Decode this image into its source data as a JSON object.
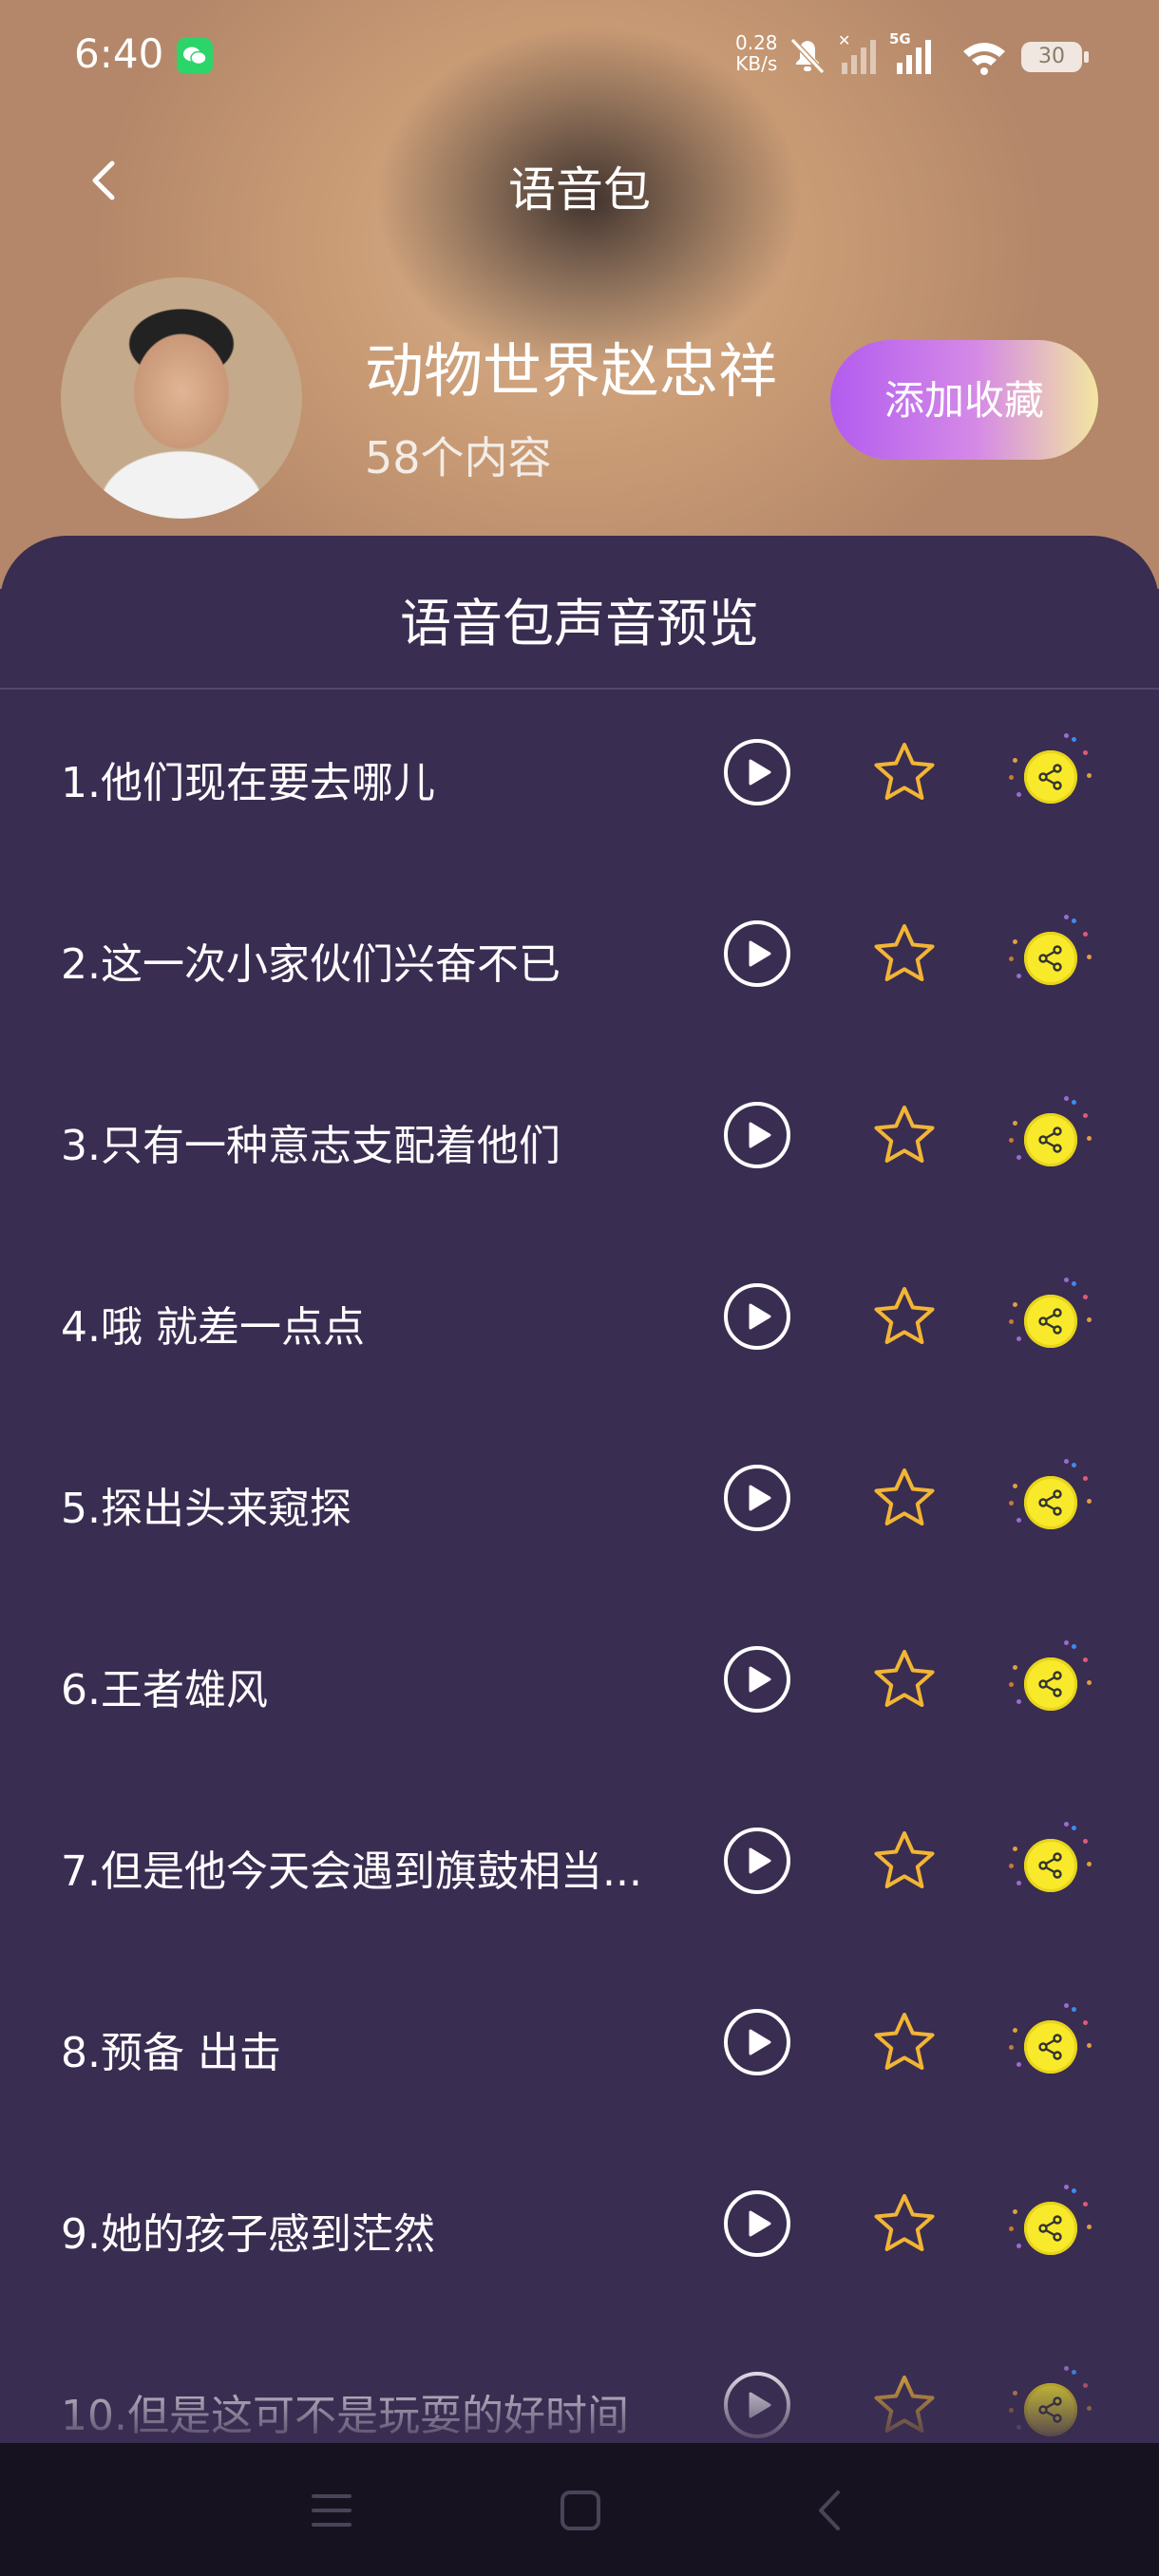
{
  "status_bar": {
    "time": "6:40",
    "net_speed_value": "0.28",
    "net_speed_unit": "KB/s",
    "network": "5G",
    "battery": "30"
  },
  "header": {
    "title": "语音包"
  },
  "artist": {
    "name": "动物世界赵忠祥",
    "count": "58个内容",
    "fav_label": "添加收藏"
  },
  "panel": {
    "title": "语音包声音预览"
  },
  "items": [
    {
      "label": "1.他们现在要去哪儿"
    },
    {
      "label": "2.这一次小家伙们兴奋不已"
    },
    {
      "label": "3.只有一种意志支配着他们"
    },
    {
      "label": "4.哦 就差一点点"
    },
    {
      "label": "5.探出头来窥探"
    },
    {
      "label": "6.王者雄风"
    },
    {
      "label": "7.但是他今天会遇到旗鼓相当..."
    },
    {
      "label": "8.预备 出击"
    },
    {
      "label": "9.她的孩子感到茫然"
    },
    {
      "label": "10.但是这可不是玩耍的好时间"
    }
  ],
  "icons": {
    "play": "play-icon",
    "star": "star-outline-icon",
    "share": "share-icon"
  },
  "colors": {
    "background": "#3a2d52",
    "star": "#f2b534",
    "share_coin": "#f8ea2a",
    "fav_gradient_start": "#b35cf0",
    "fav_gradient_end": "#f2e6a0"
  }
}
